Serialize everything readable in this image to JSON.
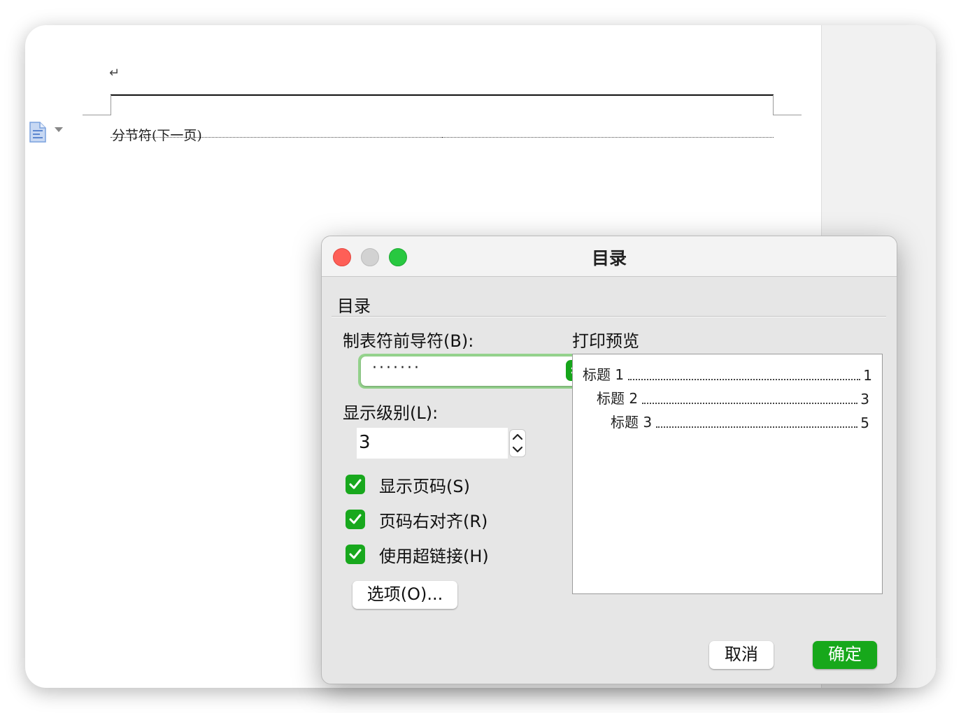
{
  "document": {
    "section_break_label": "分节符(下一页)"
  },
  "dialog": {
    "title": "目录",
    "group_title": "目录",
    "leader": {
      "label": "制表符前导符(B):",
      "value": "·······"
    },
    "level": {
      "label": "显示级别(L):",
      "value": "3"
    },
    "checkboxes": [
      {
        "label": "显示页码(S)",
        "checked": true
      },
      {
        "label": "页码右对齐(R)",
        "checked": true
      },
      {
        "label": "使用超链接(H)",
        "checked": true
      }
    ],
    "options_button": "选项(O)...",
    "preview": {
      "label": "打印预览",
      "entries": [
        {
          "text": "标题 1",
          "page": "1"
        },
        {
          "text": "标题 2",
          "page": "3"
        },
        {
          "text": "标题 3",
          "page": "5"
        }
      ]
    },
    "cancel_button": "取消",
    "ok_button": "确定"
  },
  "colors": {
    "accent_green": "#17a81b",
    "close": "#fe5f57",
    "minimize": "#d2d2d2",
    "zoom": "#28c840"
  }
}
